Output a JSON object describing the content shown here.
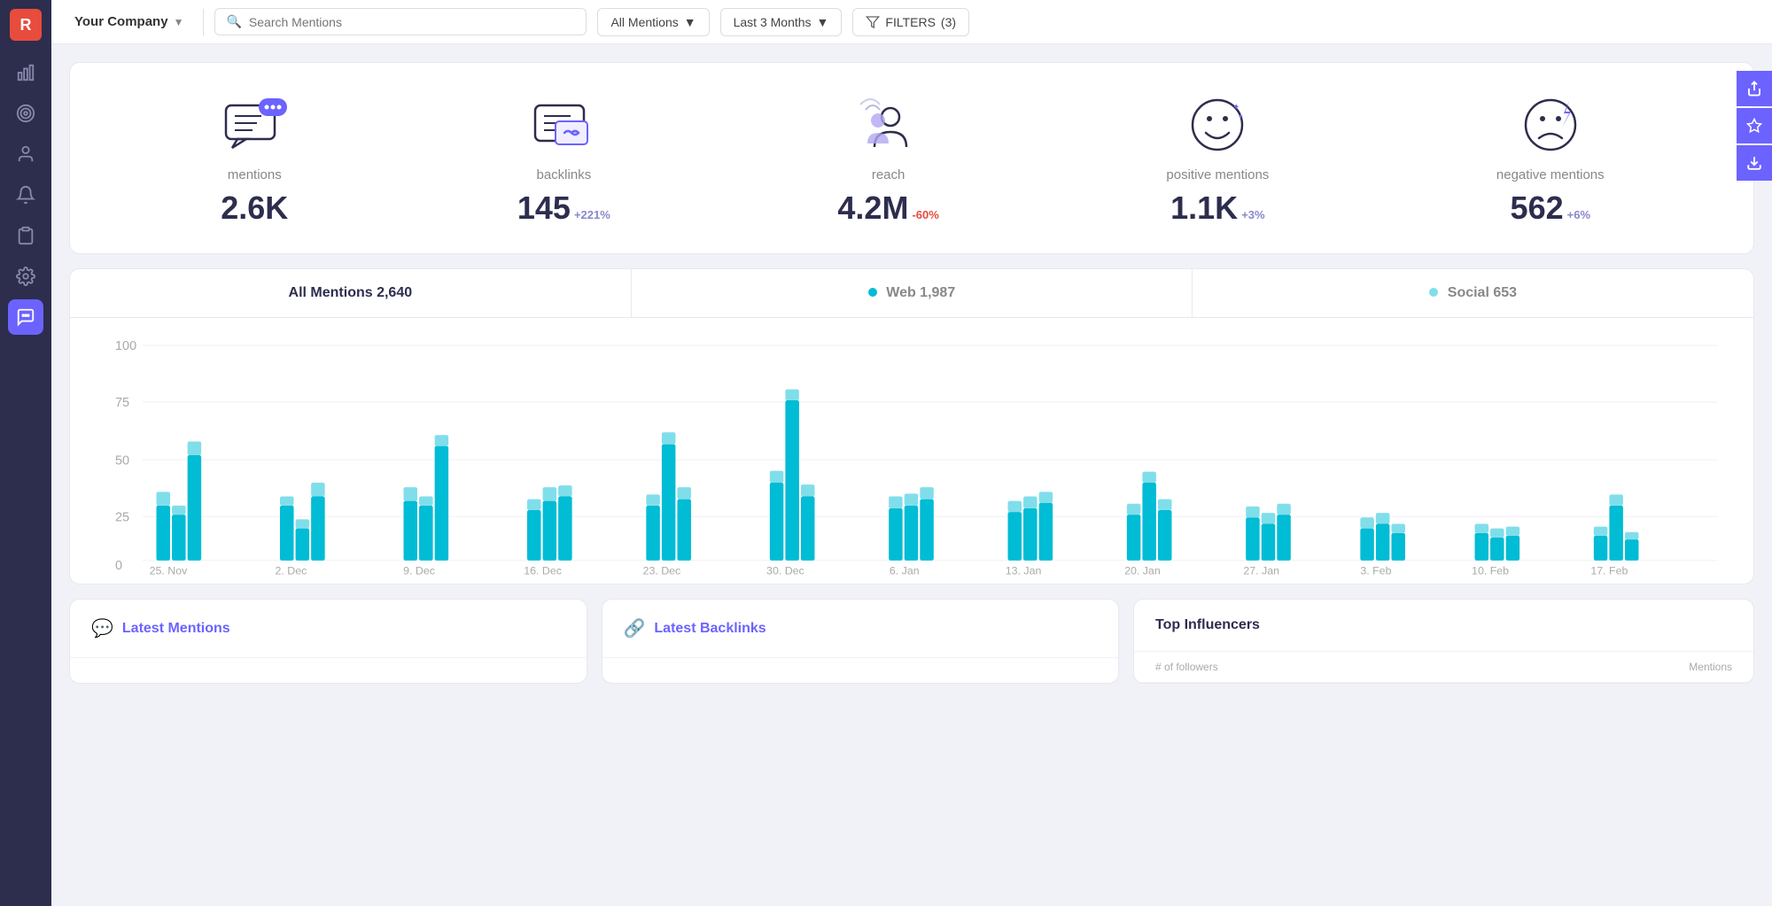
{
  "app": {
    "logo_letter": "R"
  },
  "topbar": {
    "company_name": "Your Company",
    "search_placeholder": "Search Mentions",
    "mentions_filter": "All Mentions",
    "time_filter": "Last 3 Months",
    "filters_label": "FILTERS",
    "filters_count": "(3)"
  },
  "sidebar": {
    "icons": [
      {
        "name": "chart-icon",
        "symbol": "📊",
        "active": false
      },
      {
        "name": "target-icon",
        "symbol": "🎯",
        "active": false
      },
      {
        "name": "user-icon",
        "symbol": "👤",
        "active": false
      },
      {
        "name": "bell-icon",
        "symbol": "🔔",
        "active": false
      },
      {
        "name": "clipboard-icon",
        "symbol": "📋",
        "active": false
      },
      {
        "name": "settings-icon",
        "symbol": "⚙️",
        "active": false
      },
      {
        "name": "mentions-icon",
        "symbol": "💬",
        "active": true
      }
    ]
  },
  "stats": [
    {
      "id": "mentions",
      "label": "mentions",
      "value": "2.6K",
      "change": null,
      "change_type": null
    },
    {
      "id": "backlinks",
      "label": "backlinks",
      "value": "145",
      "change": "+221%",
      "change_type": "positive"
    },
    {
      "id": "reach",
      "label": "reach",
      "value": "4.2M",
      "change": "-60%",
      "change_type": "negative"
    },
    {
      "id": "positive",
      "label": "positive mentions",
      "value": "1.1K",
      "change": "+3%",
      "change_type": "positive"
    },
    {
      "id": "negative",
      "label": "negative mentions",
      "value": "562",
      "change": "+6%",
      "change_type": "positive"
    }
  ],
  "chart": {
    "tabs": [
      {
        "label": "All Mentions 2,640",
        "active": true,
        "dot": null
      },
      {
        "label": "Web 1,987",
        "active": false,
        "dot": "web"
      },
      {
        "label": "Social 653",
        "active": false,
        "dot": "social"
      }
    ],
    "x_labels": [
      "25. Nov",
      "2. Dec",
      "9. Dec",
      "16. Dec",
      "23. Dec",
      "30. Dec",
      "6. Jan",
      "13. Jan",
      "20. Jan",
      "27. Jan",
      "3. Feb",
      "10. Feb",
      "17. Feb"
    ],
    "y_labels": [
      "0",
      "25",
      "50",
      "75",
      "100"
    ]
  },
  "bottom": {
    "mentions_label": "Latest Mentions",
    "backlinks_label": "Latest Backlinks",
    "influencers_label": "Top Influencers",
    "followers_label": "# of followers",
    "mentions_col": "Mentions"
  },
  "right_sidebar": {
    "share_icon": "↗",
    "star_icon": "★",
    "download_icon": "↓"
  }
}
